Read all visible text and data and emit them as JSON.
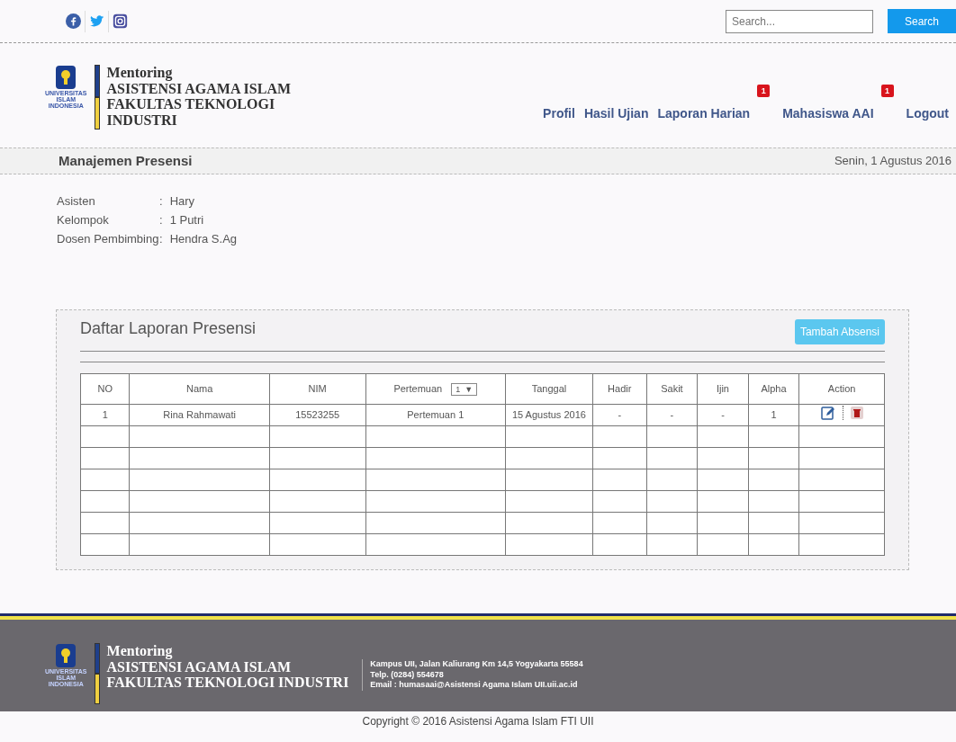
{
  "topbar": {
    "social": [
      {
        "kind": "facebook"
      },
      {
        "kind": "twitter"
      },
      {
        "kind": "instagram"
      }
    ],
    "search": {
      "placeholder": "Search..."
    },
    "search_button": "Search"
  },
  "brand": {
    "logo_lines": [
      "UNIVERSITAS",
      "ISLAM",
      "INDONESIA"
    ],
    "title": "Mentoring",
    "subtitle_lines": [
      "ASISTENSI AGAMA ISLAM",
      "FAKULTAS TEKNOLOGI",
      "INDUSTRI"
    ]
  },
  "nav": [
    {
      "label": "Profil"
    },
    {
      "label": "Hasil Ujian"
    },
    {
      "label": "Laporan Harian",
      "badge": "1"
    },
    {
      "label": "Mahasiswa AAI",
      "badge": "1"
    },
    {
      "label": "Logout"
    }
  ],
  "page_header": {
    "title": "Manajemen Presensi",
    "date": "Senin, 1 Agustus 2016"
  },
  "info": [
    {
      "label": "Asisten",
      "separator": ":",
      "value": "Hary"
    },
    {
      "label": "Kelompok",
      "separator": ":",
      "value": "1 Putri"
    },
    {
      "label": "Dosen Pembimbing",
      "separator": ":",
      "value": "Hendra S.Ag"
    }
  ],
  "panel": {
    "title": "Daftar Laporan Presensi",
    "button": "Tambah Absensi",
    "table": {
      "columns": [
        "NO",
        "Nama",
        "NIM",
        "Pertemuan",
        "Tanggal",
        "Hadir",
        "Sakit",
        "Ijin",
        "Alpha",
        "Action"
      ],
      "pertemuan_select": {
        "value": "1",
        "arrow": "▼"
      },
      "rows": [
        [
          "1",
          "Rina Rahmawati",
          "15523255",
          "Pertemuan 1",
          "15 Agustus 2016",
          "-",
          "-",
          "-",
          "1"
        ]
      ]
    }
  },
  "footer": {
    "logo_lines": [
      "UNIVERSITAS",
      "ISLAM",
      "INDONESIA"
    ],
    "title": "Mentoring",
    "subtitle_lines": [
      "ASISTENSI AGAMA ISLAM",
      "FAKULTAS TEKNOLOGI INDUSTRI"
    ],
    "contact": [
      "Kampus UII, Jalan Kaliurang Km 14,5 Yogyakarta 55584",
      "Telp. (0284) 554678",
      "Email : humasaai@Asistensi Agama Islam UII.uii.ac.id"
    ],
    "copyright": "Copyright © 2016 Asistensi Agama Islam FTI UII"
  }
}
